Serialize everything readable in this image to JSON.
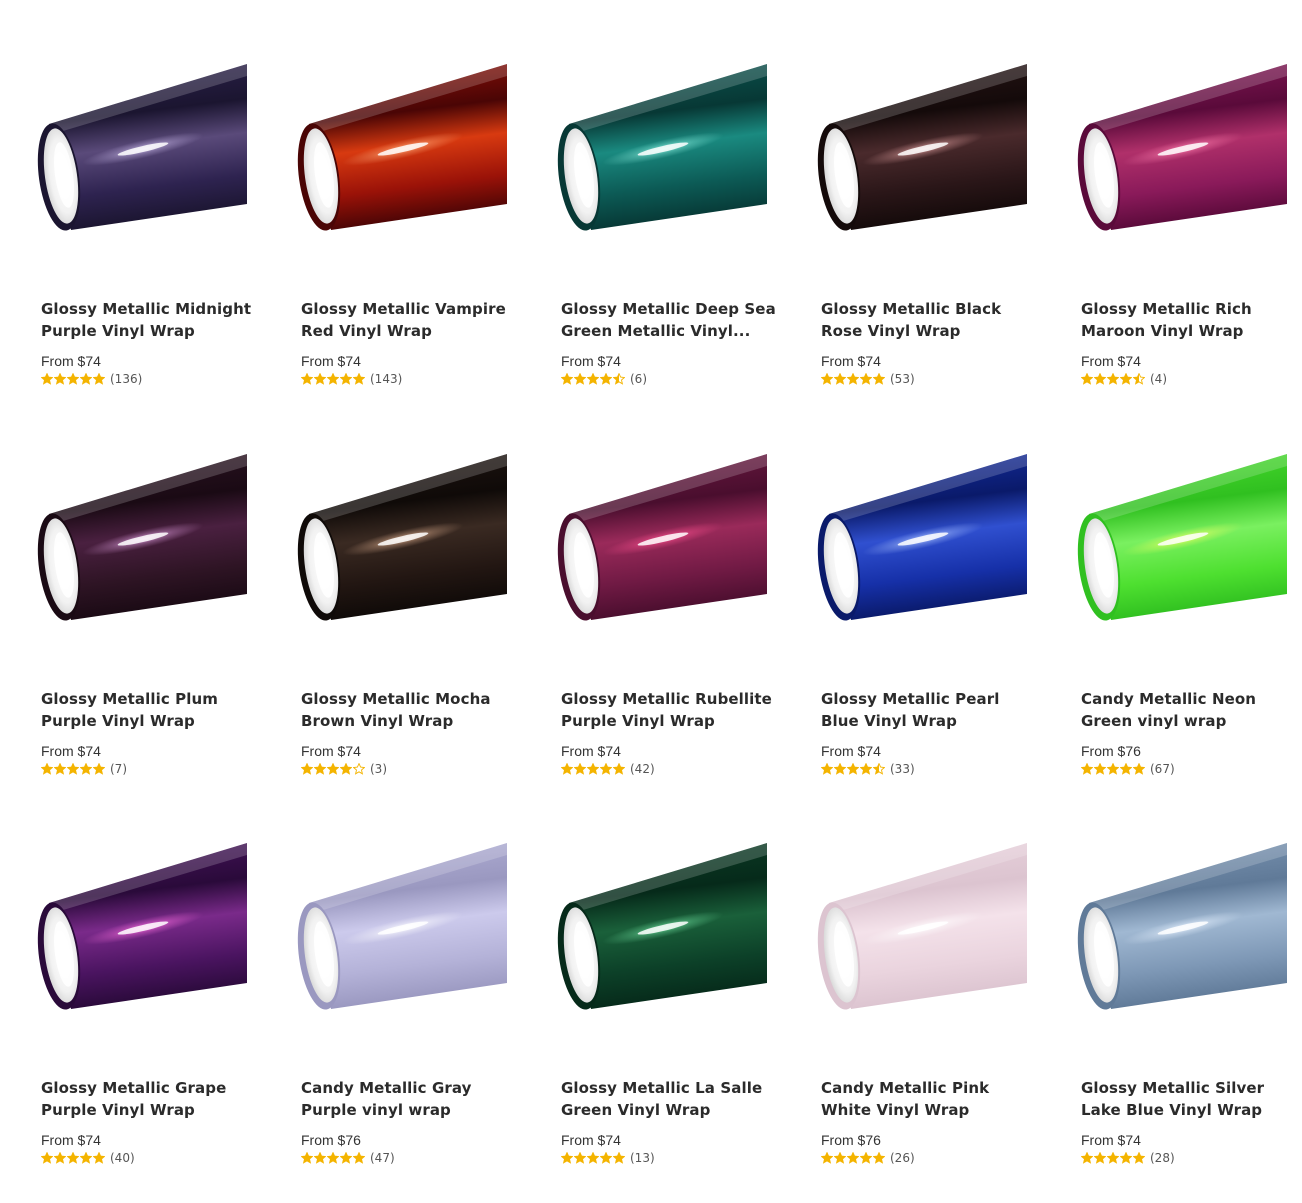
{
  "products": [
    {
      "title": "Glossy Metallic Midnight Purple Vinyl Wrap",
      "price": "From $74",
      "rating": 5,
      "reviews": "(136)",
      "colors": {
        "dark": "#1b1530",
        "mid": "#2e2350",
        "light": "#5a4a7a",
        "hi": "#c8b8e8"
      }
    },
    {
      "title": "Glossy Metallic Vampire Red Vinyl Wrap",
      "price": "From $74",
      "rating": 5,
      "reviews": "(143)",
      "colors": {
        "dark": "#4a0505",
        "mid": "#9a1208",
        "light": "#d83a10",
        "hi": "#ffb080"
      }
    },
    {
      "title": "Glossy Metallic Deep Sea Green Metallic Vinyl...",
      "price": "From $74",
      "rating": 4.5,
      "reviews": "(6)",
      "colors": {
        "dark": "#073835",
        "mid": "#0c5a55",
        "light": "#1a8a80",
        "hi": "#8ff0e0"
      }
    },
    {
      "title": "Glossy Metallic Black Rose Vinyl Wrap",
      "price": "From $74",
      "rating": 5,
      "reviews": "(53)",
      "colors": {
        "dark": "#140a0a",
        "mid": "#2a1618",
        "light": "#4a2a2c",
        "hi": "#e0a0a0"
      }
    },
    {
      "title": "Glossy Metallic Rich Maroon Vinyl Wrap",
      "price": "From $74",
      "rating": 4.5,
      "reviews": "(4)",
      "colors": {
        "dark": "#5a0a3a",
        "mid": "#8a1a5a",
        "light": "#b0306a",
        "hi": "#ff80b0"
      }
    },
    {
      "title": "Glossy Metallic Plum Purple Vinyl Wrap",
      "price": "From $74",
      "rating": 5,
      "reviews": "(7)",
      "colors": {
        "dark": "#1a0a14",
        "mid": "#2e1424",
        "light": "#4a2040",
        "hi": "#e0a0e0"
      }
    },
    {
      "title": "Glossy Metallic Mocha Brown Vinyl Wrap",
      "price": "From $74",
      "rating": 4,
      "reviews": "(3)",
      "colors": {
        "dark": "#0f0a08",
        "mid": "#221612",
        "light": "#3a2a22",
        "hi": "#e0b090"
      }
    },
    {
      "title": "Glossy Metallic Rubellite Purple Vinyl Wrap",
      "price": "From $74",
      "rating": 5,
      "reviews": "(42)",
      "colors": {
        "dark": "#4a0e2e",
        "mid": "#701a44",
        "light": "#9a2a5a",
        "hi": "#ff5090"
      }
    },
    {
      "title": "Glossy Metallic Pearl Blue Vinyl Wrap",
      "price": "From $74",
      "rating": 4.5,
      "reviews": "(33)",
      "colors": {
        "dark": "#0a1a6a",
        "mid": "#1630a8",
        "light": "#3050d0",
        "hi": "#b0c8ff"
      }
    },
    {
      "title": "Candy Metallic Neon Green vinyl wrap",
      "price": "From $76",
      "rating": 5,
      "reviews": "(67)",
      "colors": {
        "dark": "#30c020",
        "mid": "#4ee030",
        "light": "#7af060",
        "hi": "#f0ff60"
      }
    },
    {
      "title": "Glossy Metallic Grape Purple Vinyl Wrap",
      "price": "From $74",
      "rating": 5,
      "reviews": "(40)",
      "colors": {
        "dark": "#2a0a3a",
        "mid": "#4a1460",
        "light": "#7a2a8a",
        "hi": "#ff70e0"
      }
    },
    {
      "title": "Candy Metallic Gray Purple vinyl wrap",
      "price": "From $76",
      "rating": 5,
      "reviews": "(47)",
      "colors": {
        "dark": "#9a98c0",
        "mid": "#b4b2d8",
        "light": "#cccaec",
        "hi": "#ffffff"
      }
    },
    {
      "title": "Glossy Metallic La Salle Green Vinyl Wrap",
      "price": "From $74",
      "rating": 5,
      "reviews": "(13)",
      "colors": {
        "dark": "#062a1a",
        "mid": "#0c4028",
        "light": "#1a603a",
        "hi": "#70e0a0"
      }
    },
    {
      "title": "Candy Metallic Pink White Vinyl Wrap",
      "price": "From $76",
      "rating": 5,
      "reviews": "(26)",
      "colors": {
        "dark": "#dcc4d0",
        "mid": "#ead4de",
        "light": "#f4e2ea",
        "hi": "#ffffff"
      }
    },
    {
      "title": "Glossy Metallic Silver Lake Blue Vinyl Wrap",
      "price": "From $74",
      "rating": 5,
      "reviews": "(28)",
      "colors": {
        "dark": "#607a98",
        "mid": "#7e98b6",
        "light": "#a0b8d2",
        "hi": "#e8f2ff"
      }
    }
  ],
  "star_color": "#f4b400"
}
